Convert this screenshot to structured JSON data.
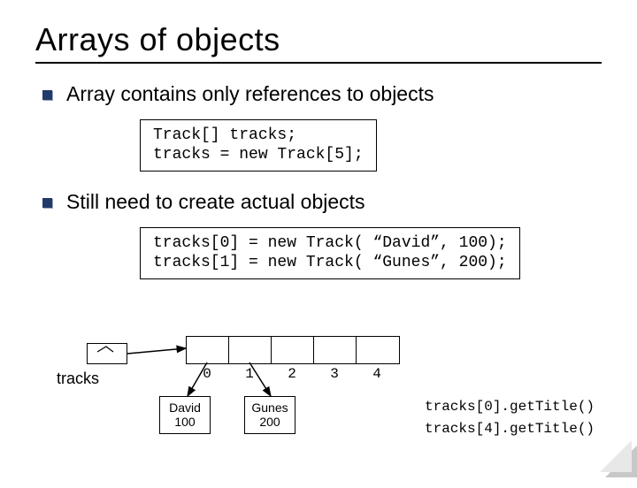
{
  "title": "Arrays of objects",
  "bullets": {
    "b1": "Array contains only references to objects",
    "b2": "Still need to create actual objects"
  },
  "code": {
    "block1": "Track[] tracks;\ntracks = new Track[5];",
    "block2": "tracks[0] = new Track( “David”, 100);\ntracks[1] = new Track( “Gunes”, 200);"
  },
  "diagram": {
    "var_label": "tracks",
    "indices": [
      "0",
      "1",
      "2",
      "3",
      "4"
    ],
    "objects": [
      {
        "name": "David",
        "val": "100"
      },
      {
        "name": "Gunes",
        "val": "200"
      }
    ],
    "calls": "tracks[0].getTitle()\ntracks[4].getTitle()"
  }
}
